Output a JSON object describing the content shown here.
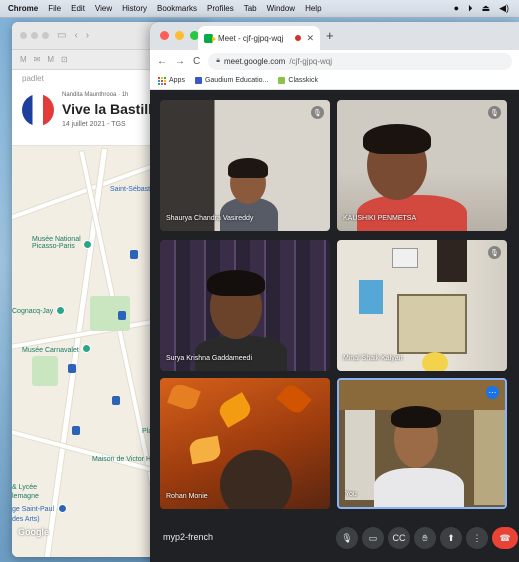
{
  "menubar": {
    "app": "Chrome",
    "items": [
      "File",
      "Edit",
      "View",
      "History",
      "Bookmarks",
      "Profiles",
      "Tab",
      "Window",
      "Help"
    ]
  },
  "padlet": {
    "site": "padlet",
    "author": "Nandita Maunthrooa",
    "author_extra": "1h",
    "title": "Vive la Bastille",
    "date": "14 juillet 2021 - TGS",
    "map_labels": {
      "saint_sebastien": "Saint-Sébast",
      "musee_picasso": "Musée National Picasso-Paris",
      "cognacq": "Cognacq-Jay",
      "carnavalet": "Musée Carnavalet",
      "maison_victor": "Maison de Victor H",
      "lycee": "& Lycée",
      "lycee2": "lemagne",
      "saint_paul": "ge Saint-Paul",
      "saint_paul2": "des Arts)",
      "place": "Plac",
      "google": "Google"
    }
  },
  "chrome": {
    "tab_title": "Meet - cjf-gjpq-wqj",
    "url_domain": "meet.google.com",
    "url_path": "/cjf-gjpq-wqj",
    "bookmarks": [
      "Apps",
      "Gaudium Educatio...",
      "Classkick"
    ]
  },
  "meet": {
    "participants": [
      {
        "name": "Shaurya Chandra Vasireddy",
        "muted": true
      },
      {
        "name": "KAUSHIKI PENMETSA",
        "muted": true
      },
      {
        "name": "Surya Krishna Gaddameedi",
        "muted": false
      },
      {
        "name": "Minal Shaik Kalyan",
        "muted": true
      },
      {
        "name": "Rohan Monie",
        "muted": false
      },
      {
        "name": "You",
        "muted": false
      }
    ],
    "meeting_code": "myp2-french"
  }
}
